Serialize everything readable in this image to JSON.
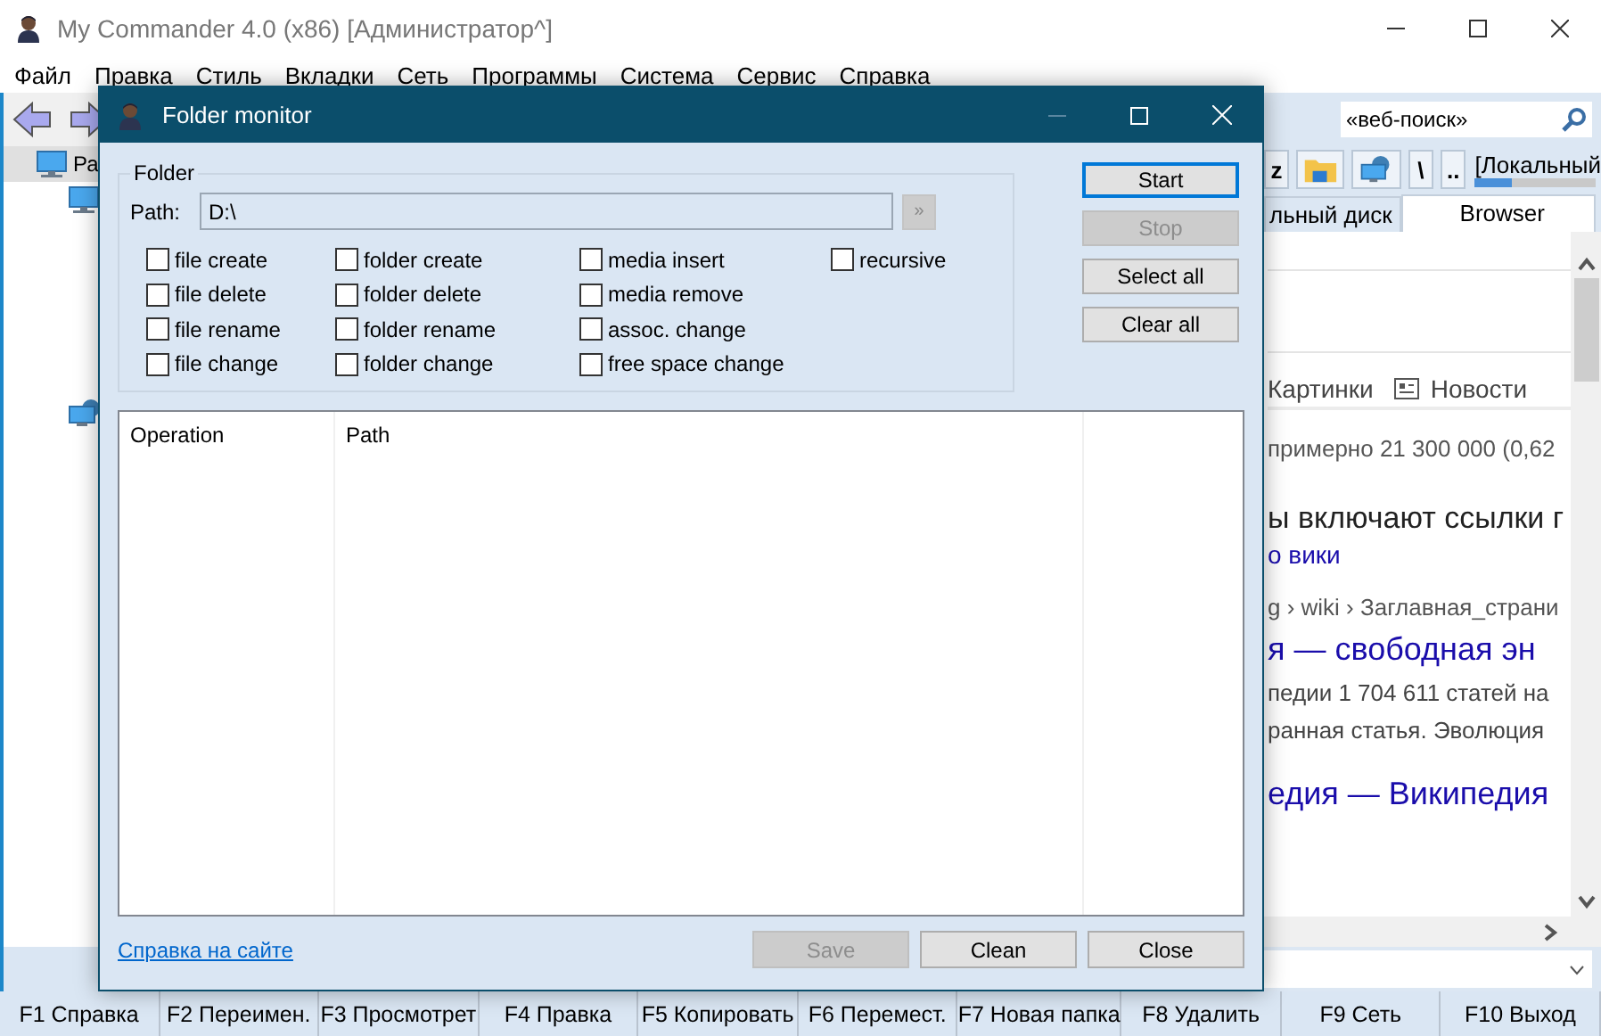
{
  "window": {
    "title": "My Commander 4.0 (x86) [Администратор^]"
  },
  "menu": [
    "Файл",
    "Правка",
    "Стиль",
    "Вкладки",
    "Сеть",
    "Программы",
    "Система",
    "Сервис",
    "Справка"
  ],
  "left_pane": {
    "items": [
      {
        "label": "Ра",
        "selected": true
      }
    ]
  },
  "right_pane": {
    "search": {
      "placeholder": "«веб-поиск»"
    },
    "toolbar": [
      {
        "kind": "text",
        "label": "z"
      },
      {
        "kind": "folder"
      },
      {
        "kind": "network"
      },
      {
        "kind": "text",
        "label": "\\"
      },
      {
        "kind": "text",
        "label": ".."
      }
    ],
    "drive": {
      "label": "[Локальный",
      "level": 0.3
    },
    "tabs": [
      {
        "label": "льный диск",
        "selected": false
      },
      {
        "label": "Browser",
        "selected": true
      }
    ],
    "browser": {
      "nav": [
        "Картинки",
        "Новости"
      ],
      "lines": [
        {
          "kind": "meta",
          "text": "примерно 21 300 000 (0,62"
        },
        {
          "kind": "heading",
          "text": "ы включают ссылки г"
        },
        {
          "kind": "link",
          "text": "о вики"
        },
        {
          "kind": "meta",
          "text": "g › wiki › Заглавная_страни"
        },
        {
          "kind": "title",
          "text": "я — свободная эн"
        },
        {
          "kind": "snippet",
          "text": "педии 1 704 611 статей на"
        },
        {
          "kind": "snippet",
          "text": "ранная статья. Эволюция"
        },
        {
          "kind": "title",
          "text": "едия — Википедия"
        }
      ]
    }
  },
  "dialog": {
    "title": "Folder monitor",
    "folder": {
      "legend": "Folder",
      "path_label": "Path:",
      "path": "D:\\",
      "browse": {
        "label": "»",
        "disabled": true
      }
    },
    "options": [
      [
        {
          "label": "file create",
          "checked": false
        },
        {
          "label": "file delete",
          "checked": false
        },
        {
          "label": "file rename",
          "checked": false
        },
        {
          "label": "file change",
          "checked": false
        }
      ],
      [
        {
          "label": "folder create",
          "checked": false
        },
        {
          "label": "folder delete",
          "checked": false
        },
        {
          "label": "folder rename",
          "checked": false
        },
        {
          "label": "folder change",
          "checked": false
        }
      ],
      [
        {
          "label": "media insert",
          "checked": false
        },
        {
          "label": "media remove",
          "checked": false
        },
        {
          "label": "assoc. change",
          "checked": false
        },
        {
          "label": "free space change",
          "checked": false
        }
      ],
      [
        {
          "label": "recursive",
          "checked": false
        }
      ]
    ],
    "buttons": [
      {
        "label": "Start",
        "disabled": false,
        "focused": true
      },
      {
        "label": "Stop",
        "disabled": true,
        "focused": false
      },
      {
        "label": "Select all",
        "disabled": false,
        "focused": false
      },
      {
        "label": "Clear all",
        "disabled": false,
        "focused": false
      }
    ],
    "list": {
      "columns": [
        "Operation",
        "Path"
      ]
    },
    "help_link": "Справка на сайте",
    "footer_buttons": [
      {
        "label": "Save",
        "disabled": true
      },
      {
        "label": "Clean",
        "disabled": false
      },
      {
        "label": "Close",
        "disabled": false
      }
    ]
  },
  "function_keys": [
    "F1 Справка",
    "F2 Переимен.",
    "F3 Просмотрет",
    "F4 Правка",
    "F5 Копировать",
    "F6 Перемест.",
    "F7 Новая папка",
    "F8 Удалить",
    "F9 Сеть",
    "F10 Выход"
  ]
}
